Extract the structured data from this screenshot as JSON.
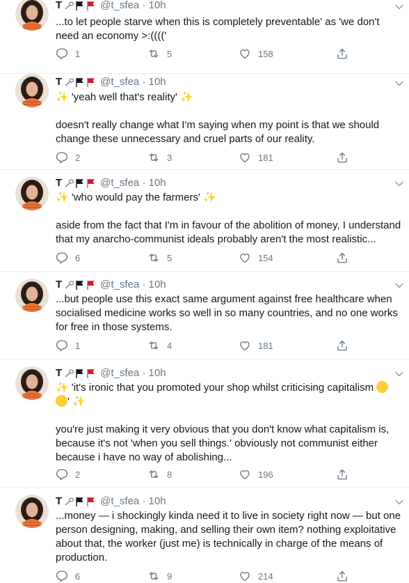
{
  "user": {
    "name": "T",
    "handle": "@t_sfea",
    "flags": [
      "tennis-flag-icon",
      "black-flag-icon",
      "red-flag-icon"
    ]
  },
  "colors": {
    "text": "#14171a",
    "secondary": "#657786",
    "divider": "#e6ecf0",
    "sparkle": "#f5b800",
    "red_flag": "#e0102a"
  },
  "tweets": [
    {
      "time": "· 10h",
      "lines": [
        "...to let people starve when this is completely preventable' as 'we don't need an economy >:(((('"
      ],
      "replies": "1",
      "retweets": "5",
      "likes": "158"
    },
    {
      "time": "· 10h",
      "quote": "'yeah well that's reality'",
      "lines": [
        "doesn't really change what I'm saying when my point is that we should change these unnecessary and cruel parts of our reality."
      ],
      "replies": "2",
      "retweets": "3",
      "likes": "181"
    },
    {
      "time": "· 10h",
      "quote": "'who would pay the farmers'",
      "lines": [
        "aside from the fact that I'm in favour of the abolition of money, I understand that my anarcho-communist ideals probably aren't the most realistic..."
      ],
      "replies": "6",
      "retweets": "5",
      "likes": "154"
    },
    {
      "time": "· 10h",
      "lines": [
        "...but people use this exact same argument against free healthcare when socialised medicine works so well in so many countries, and no one works for free in those systems."
      ],
      "replies": "1",
      "retweets": "4",
      "likes": "181"
    },
    {
      "time": "· 10h",
      "quote": "'it's ironic that you promoted your shop whilst criticising capitalism",
      "lines": [
        "you're just making it very obvious that you don't know what capitalism is, because it's not 'when you sell things.' obviously not communist either because i have no way of abolishing..."
      ],
      "replies": "2",
      "retweets": "8",
      "likes": "196"
    },
    {
      "time": "· 10h",
      "lines": [
        "...money — i shockingly kinda need it to live in society right now — but one person designing, making, and selling their own item? nothing exploitative about that, the worker (just me) is technically in charge of the means of production."
      ],
      "replies": "6",
      "retweets": "9",
      "likes": "214"
    }
  ]
}
